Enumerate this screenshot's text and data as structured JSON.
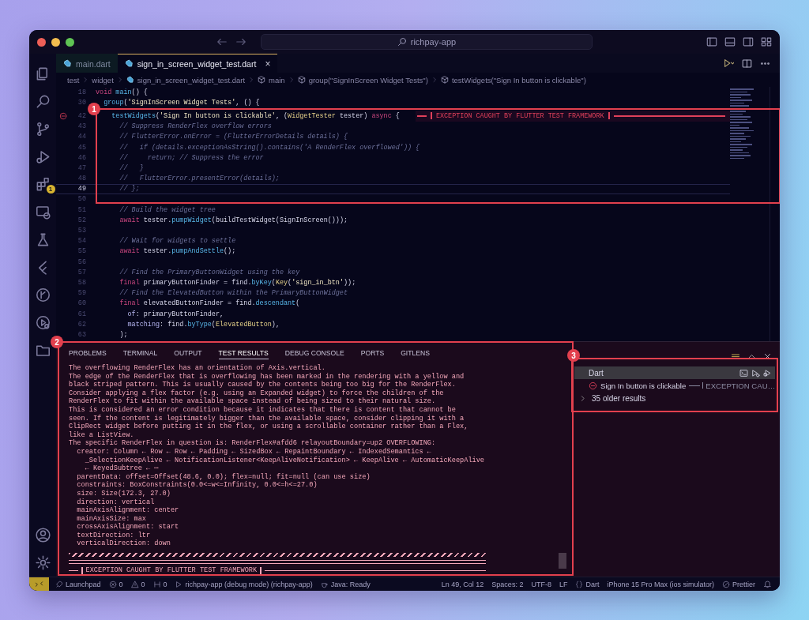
{
  "window": {
    "search": "richpay-app"
  },
  "activity_bar": {
    "badge": "1"
  },
  "tabs": [
    {
      "label": "main.dart",
      "selected": false
    },
    {
      "label": "sign_in_screen_widget_test.dart",
      "selected": true,
      "close": "×"
    }
  ],
  "breadcrumbs": [
    {
      "label": "test",
      "kind": "folder"
    },
    {
      "label": "widget",
      "kind": "folder"
    },
    {
      "label": "sign_in_screen_widget_test.dart",
      "kind": "file"
    },
    {
      "label": "main",
      "kind": "symbol"
    },
    {
      "label": "group(\"SignInScreen Widget Tests\")",
      "kind": "symbol"
    },
    {
      "label": "testWidgets(\"Sign In button is clickable\")",
      "kind": "symbol"
    }
  ],
  "code_lines": [
    {
      "number": "18",
      "current": false,
      "error": false,
      "segments": [
        {
          "text": "void",
          "kind": "keyword"
        },
        {
          "text": " main",
          "kind": "function"
        },
        {
          "text": "() {",
          "kind": "plain"
        }
      ]
    },
    {
      "number": "30",
      "current": false,
      "error": false,
      "segments": [
        {
          "text": "  group",
          "kind": "function"
        },
        {
          "text": "(",
          "kind": "plain"
        },
        {
          "text": "'SignInScreen Widget Tests'",
          "kind": "string"
        },
        {
          "text": ", () {",
          "kind": "plain"
        }
      ]
    },
    {
      "number": "42",
      "current": false,
      "error": true,
      "inline_message": "EXCEPTION CAUGHT BY FLUTTER TEST FRAMEWORK",
      "segments": [
        {
          "text": "    testWidgets",
          "kind": "function"
        },
        {
          "text": "(",
          "kind": "plain"
        },
        {
          "text": "'Sign In button is clickable'",
          "kind": "string"
        },
        {
          "text": ", (",
          "kind": "plain"
        },
        {
          "text": "WidgetTester",
          "kind": "type"
        },
        {
          "text": " tester) ",
          "kind": "plain"
        },
        {
          "text": "async",
          "kind": "keyword"
        },
        {
          "text": " {",
          "kind": "plain"
        }
      ]
    },
    {
      "number": "43",
      "current": false,
      "error": false,
      "segments": [
        {
          "text": "      // Suppress RenderFlex overflow errors",
          "kind": "comment"
        }
      ]
    },
    {
      "number": "44",
      "current": false,
      "error": false,
      "segments": [
        {
          "text": "      // FlutterError.onError = (FlutterErrorDetails details) {",
          "kind": "comment"
        }
      ]
    },
    {
      "number": "45",
      "current": false,
      "error": false,
      "segments": [
        {
          "text": "      //   if (details.exceptionAsString().contains('A RenderFlex overflowed')) {",
          "kind": "comment"
        }
      ]
    },
    {
      "number": "46",
      "current": false,
      "error": false,
      "segments": [
        {
          "text": "      //     return; // Suppress the error",
          "kind": "comment"
        }
      ]
    },
    {
      "number": "47",
      "current": false,
      "error": false,
      "segments": [
        {
          "text": "      //   }",
          "kind": "comment"
        }
      ]
    },
    {
      "number": "48",
      "current": false,
      "error": false,
      "segments": [
        {
          "text": "      //   FlutterError.presentError(details);",
          "kind": "comment"
        }
      ]
    },
    {
      "number": "49",
      "current": true,
      "error": false,
      "segments": [
        {
          "text": "      // };",
          "kind": "comment"
        }
      ]
    },
    {
      "number": "50",
      "current": false,
      "error": false
    },
    {
      "number": "51",
      "current": false,
      "error": false,
      "segments": [
        {
          "text": "      // Build the widget tree",
          "kind": "comment"
        }
      ]
    },
    {
      "number": "52",
      "current": false,
      "error": false,
      "segments": [
        {
          "text": "      await",
          "kind": "keyword"
        },
        {
          "text": " tester.",
          "kind": "plain"
        },
        {
          "text": "pumpWidget",
          "kind": "function"
        },
        {
          "text": "(buildTestWidget(SignInScreen()));",
          "kind": "plain"
        }
      ]
    },
    {
      "number": "53",
      "current": false,
      "error": false
    },
    {
      "number": "54",
      "current": false,
      "error": false,
      "segments": [
        {
          "text": "      // Wait for widgets to settle",
          "kind": "comment"
        }
      ]
    },
    {
      "number": "55",
      "current": false,
      "error": false,
      "segments": [
        {
          "text": "      await",
          "kind": "keyword"
        },
        {
          "text": " tester.",
          "kind": "plain"
        },
        {
          "text": "pumpAndSettle",
          "kind": "function"
        },
        {
          "text": "();",
          "kind": "plain"
        }
      ]
    },
    {
      "number": "56",
      "current": false,
      "error": false
    },
    {
      "number": "57",
      "current": false,
      "error": false,
      "segments": [
        {
          "text": "      // Find the PrimaryButtonWidget using the key",
          "kind": "comment"
        }
      ]
    },
    {
      "number": "58",
      "current": false,
      "error": false,
      "segments": [
        {
          "text": "      final",
          "kind": "keyword"
        },
        {
          "text": " primaryButtonFinder = find.",
          "kind": "plain"
        },
        {
          "text": "byKey",
          "kind": "function"
        },
        {
          "text": "(",
          "kind": "plain"
        },
        {
          "text": "Key",
          "kind": "type"
        },
        {
          "text": "(",
          "kind": "plain"
        },
        {
          "text": "'sign_in_btn'",
          "kind": "string"
        },
        {
          "text": "));",
          "kind": "plain"
        }
      ]
    },
    {
      "number": "59",
      "current": false,
      "error": false,
      "segments": [
        {
          "text": "      // Find the ElevatedButton within the PrimaryButtonWidget",
          "kind": "comment"
        }
      ]
    },
    {
      "number": "60",
      "current": false,
      "error": false,
      "segments": [
        {
          "text": "      final",
          "kind": "keyword"
        },
        {
          "text": " elevatedButtonFinder = find.",
          "kind": "plain"
        },
        {
          "text": "descendant",
          "kind": "function"
        },
        {
          "text": "(",
          "kind": "plain"
        }
      ]
    },
    {
      "number": "61",
      "current": false,
      "error": false,
      "segments": [
        {
          "text": "        of",
          "kind": "param"
        },
        {
          "text": ": primaryButtonFinder,",
          "kind": "plain"
        }
      ]
    },
    {
      "number": "62",
      "current": false,
      "error": false,
      "segments": [
        {
          "text": "        matching",
          "kind": "param"
        },
        {
          "text": ": find.",
          "kind": "plain"
        },
        {
          "text": "byType",
          "kind": "function"
        },
        {
          "text": "(",
          "kind": "plain"
        },
        {
          "text": "ElevatedButton",
          "kind": "type"
        },
        {
          "text": "),",
          "kind": "plain"
        }
      ]
    },
    {
      "number": "63",
      "current": false,
      "error": false,
      "segments": [
        {
          "text": "      );",
          "kind": "plain"
        }
      ]
    }
  ],
  "panel": {
    "tabs": [
      {
        "label": "PROBLEMS",
        "selected": false
      },
      {
        "label": "TERMINAL",
        "selected": false
      },
      {
        "label": "OUTPUT",
        "selected": false
      },
      {
        "label": "TEST RESULTS",
        "selected": true
      },
      {
        "label": "DEBUG CONSOLE",
        "selected": false
      },
      {
        "label": "PORTS",
        "selected": false
      },
      {
        "label": "GITLENS",
        "selected": false
      }
    ],
    "output": [
      {
        "kind": "text",
        "text": "The overflowing RenderFlex has an orientation of Axis.vertical."
      },
      {
        "kind": "text",
        "text": "The edge of the RenderFlex that is overflowing has been marked in the rendering with a yellow and"
      },
      {
        "kind": "text",
        "text": "black striped pattern. This is usually caused by the contents being too big for the RenderFlex."
      },
      {
        "kind": "text",
        "text": "Consider applying a flex factor (e.g. using an Expanded widget) to force the children of the"
      },
      {
        "kind": "text",
        "text": "RenderFlex to fit within the available space instead of being sized to their natural size."
      },
      {
        "kind": "text",
        "text": "This is considered an error condition because it indicates that there is content that cannot be"
      },
      {
        "kind": "text",
        "text": "seen. If the content is legitimately bigger than the available space, consider clipping it with a"
      },
      {
        "kind": "text",
        "text": "ClipRect widget before putting it in the flex, or using a scrollable container rather than a Flex,"
      },
      {
        "kind": "text",
        "text": "like a ListView."
      },
      {
        "kind": "text",
        "text": "The specific RenderFlex in question is: RenderFlex#afdd6 relayoutBoundary=up2 OVERFLOWING:"
      },
      {
        "kind": "text",
        "text": "  creator: Column ← Row ← Row ← Padding ← SizedBox ← RepaintBoundary ← IndexedSemantics ←"
      },
      {
        "kind": "text",
        "text": "    _SelectionKeepAlive ← NotificationListener<KeepAliveNotification> ← KeepAlive ← AutomaticKeepAlive"
      },
      {
        "kind": "text",
        "text": "    ← KeyedSubtree ← ⋯"
      },
      {
        "kind": "text",
        "text": "  parentData: offset=Offset(48.6, 0.0); flex=null; fit=null (can use size)"
      },
      {
        "kind": "text",
        "text": "  constraints: BoxConstraints(0.0<=w<=Infinity, 0.0<=h<=27.0)"
      },
      {
        "kind": "text",
        "text": "  size: Size(172.3, 27.0)"
      },
      {
        "kind": "text",
        "text": "  direction: vertical"
      },
      {
        "kind": "text",
        "text": "  mainAxisAlignment: center"
      },
      {
        "kind": "text",
        "text": "  mainAxisSize: max"
      },
      {
        "kind": "text",
        "text": "  crossAxisAlignment: start"
      },
      {
        "kind": "text",
        "text": "  textDirection: ltr"
      },
      {
        "kind": "text",
        "text": "  verticalDirection: down"
      },
      {
        "kind": "stripes"
      },
      {
        "kind": "rule"
      },
      {
        "kind": "banner",
        "text": "EXCEPTION CAUGHT BY FLUTTER TEST FRAMEWORK"
      }
    ]
  },
  "test_results": {
    "groups": [
      {
        "label": "Dart",
        "selected": true,
        "children": [
          {
            "label": "Sign In button is clickable",
            "kind": "failed",
            "message": "EXCEPTION CAU…"
          }
        ]
      }
    ],
    "older": {
      "label": "35 older results",
      "expanded": false
    }
  },
  "status_bar": {
    "left": [
      {
        "kind": "rocket",
        "text": "Launchpad"
      },
      {
        "kind": "errors",
        "text": "0"
      },
      {
        "kind": "warnings",
        "text": "0"
      },
      {
        "kind": "ports",
        "text": "0"
      },
      {
        "kind": "debug",
        "text": "richpay-app (debug mode) (richpay-app)"
      },
      {
        "kind": "java",
        "text": "Java: Ready"
      }
    ],
    "right": [
      {
        "kind": "plain",
        "text": "Ln 49, Col 12"
      },
      {
        "kind": "plain",
        "text": "Spaces: 2"
      },
      {
        "kind": "plain",
        "text": "UTF-8"
      },
      {
        "kind": "plain",
        "text": "LF"
      },
      {
        "kind": "braces",
        "text": "Dart"
      },
      {
        "kind": "plain",
        "text": "iPhone 15 Pro Max (ios simulator)"
      },
      {
        "kind": "prettier",
        "text": "Prettier"
      }
    ]
  },
  "annotations": [
    {
      "label": "1"
    },
    {
      "label": "2"
    },
    {
      "label": "3"
    }
  ]
}
